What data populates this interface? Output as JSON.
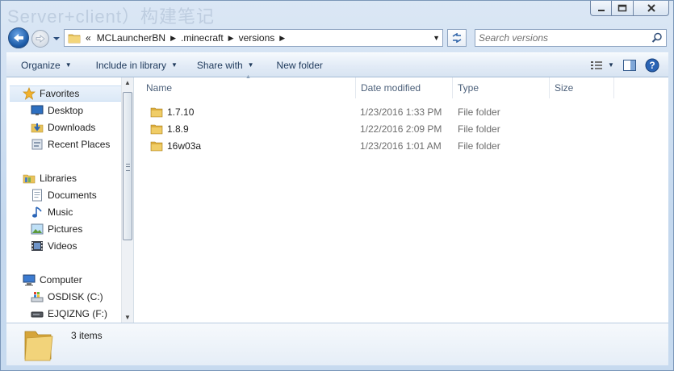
{
  "window": {
    "title_ghost": "Server+client）构建笔记"
  },
  "navigation": {
    "breadcrumb_overflow": "«",
    "breadcrumb": [
      "MCLauncherBN",
      ".minecraft",
      "versions"
    ],
    "search_placeholder": "Search versions"
  },
  "toolbar": {
    "organize": "Organize",
    "include_in_library": "Include in library",
    "share_with": "Share with",
    "new_folder": "New folder"
  },
  "nav_pane": {
    "favorites": "Favorites",
    "favorites_items": [
      "Desktop",
      "Downloads",
      "Recent Places"
    ],
    "libraries": "Libraries",
    "libraries_items": [
      "Documents",
      "Music",
      "Pictures",
      "Videos"
    ],
    "computer": "Computer",
    "computer_items": [
      "OSDISK (C:)",
      "EJQIZNG (F:)"
    ]
  },
  "columns": {
    "name": "Name",
    "date_modified": "Date modified",
    "type": "Type",
    "size": "Size"
  },
  "files": [
    {
      "name": "1.7.10",
      "date": "1/23/2016 1:33 PM",
      "type": "File folder"
    },
    {
      "name": "1.8.9",
      "date": "1/22/2016 2:09 PM",
      "type": "File folder"
    },
    {
      "name": "16w03a",
      "date": "1/23/2016 1:01 AM",
      "type": "File folder"
    }
  ],
  "details": {
    "count": "3 items"
  },
  "colors": {
    "accent": "#1d5ca8",
    "folder": "#e8c35a"
  }
}
